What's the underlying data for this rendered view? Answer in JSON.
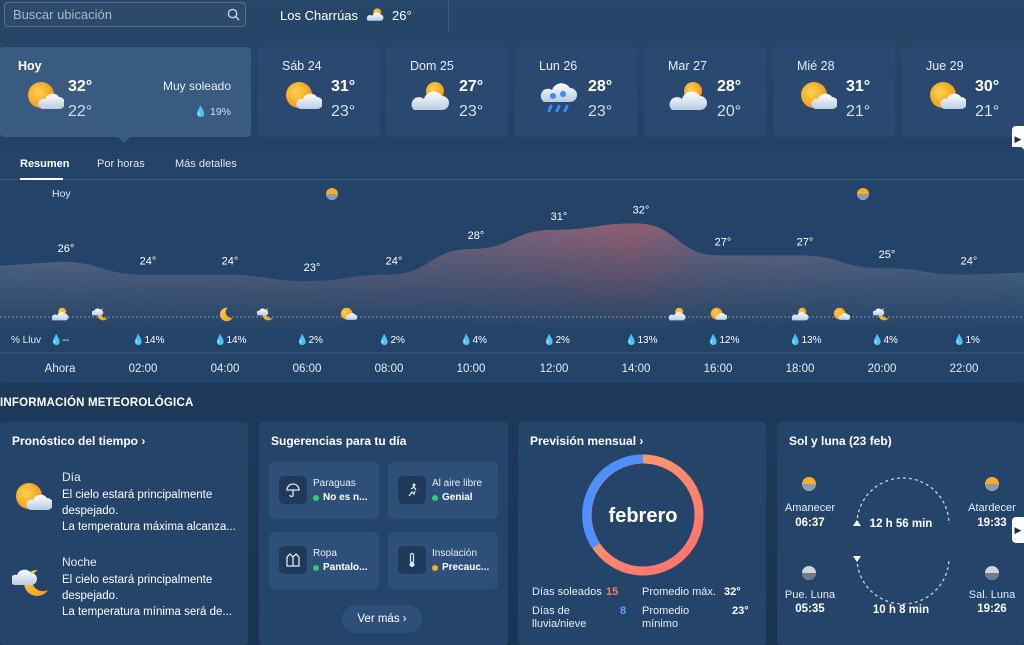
{
  "search": {
    "placeholder": "Buscar ubicación",
    "value": ""
  },
  "location": {
    "name": "Los Charrúas",
    "temp": "26°"
  },
  "today": {
    "label": "Hoy",
    "high": "32°",
    "low": "22°",
    "condition": "Muy soleado",
    "rain": "19%"
  },
  "days": [
    {
      "label": "Sáb 24",
      "high": "31°",
      "low": "23°",
      "icon": "sun-cloud-icon"
    },
    {
      "label": "Dom 25",
      "high": "27°",
      "low": "23°",
      "icon": "cloud-sun-icon"
    },
    {
      "label": "Lun 26",
      "high": "28°",
      "low": "23°",
      "icon": "rain-cloud-icon"
    },
    {
      "label": "Mar 27",
      "high": "28°",
      "low": "20°",
      "icon": "cloud-sun-icon"
    },
    {
      "label": "Mié 28",
      "high": "31°",
      "low": "21°",
      "icon": "sun-cloud-icon"
    },
    {
      "label": "Jue 29",
      "high": "30°",
      "low": "21°",
      "icon": "sun-cloud-icon"
    }
  ],
  "tabs": {
    "summary": "Resumen",
    "hourly": "Por horas",
    "details": "Más detalles"
  },
  "hourly": {
    "today_label": "Hoy",
    "rain_label": "% Lluv",
    "temps": [
      {
        "value": 26,
        "label": "26°"
      },
      {
        "value": 24,
        "label": "24°"
      },
      {
        "value": 24,
        "label": "24°"
      },
      {
        "value": 23,
        "label": "23°"
      },
      {
        "value": 24,
        "label": "24°"
      },
      {
        "value": 28,
        "label": "28°"
      },
      {
        "value": 31,
        "label": "31°"
      },
      {
        "value": 32,
        "label": "32°"
      },
      {
        "value": 27,
        "label": "27°"
      },
      {
        "value": 27,
        "label": "27°"
      },
      {
        "value": 25,
        "label": "25°"
      },
      {
        "value": 24,
        "label": "24°"
      }
    ],
    "rain": [
      "--",
      "14%",
      "14%",
      "2%",
      "2%",
      "4%",
      "2%",
      "13%",
      "12%",
      "13%",
      "4%",
      "1%"
    ],
    "times": [
      "Ahora",
      "02:00",
      "04:00",
      "06:00",
      "08:00",
      "10:00",
      "12:00",
      "14:00",
      "16:00",
      "18:00",
      "20:00",
      "22:00"
    ]
  },
  "info": {
    "section_title": "INFORMACIÓN METEOROLÓGICA",
    "forecast": {
      "title": "Pronóstico del tiempo",
      "day_label": "Día",
      "day_lines": [
        "El cielo estará principalmente",
        "despejado.",
        "La temperatura máxima alcanza..."
      ],
      "night_label": "Noche",
      "night_lines": [
        "El cielo estará principalmente",
        "despejado.",
        "La temperatura mínima será de..."
      ]
    },
    "suggestions": {
      "title": "Sugerencias para tu día",
      "items": [
        {
          "name": "Paraguas",
          "value": "No es n...",
          "color": "#2ecc71"
        },
        {
          "name": "Al aire libre",
          "value": "Genial",
          "color": "#2ecc71"
        },
        {
          "name": "Ropa",
          "value": "Pantalo...",
          "color": "#2ecc71"
        },
        {
          "name": "Insolación",
          "value": "Precauc...",
          "color": "#f1b31c"
        }
      ],
      "more": "Ver más"
    },
    "monthly": {
      "title": "Previsión mensual",
      "month": "febrero",
      "sunny_label": "Días soleados",
      "sunny_value": "15",
      "rain_label": "Días de lluvia/nieve",
      "rain_value": "8",
      "max_label": "Promedio máx.",
      "max_value": "32°",
      "min_label": "Promedio mínimo",
      "min_value": "23°",
      "sunny_color": "#ff7b6b",
      "rain_color": "#5aa3ff"
    },
    "sunmoon": {
      "title": "Sol y luna (23 feb)",
      "sunrise_label": "Amanecer",
      "sunrise": "06:37",
      "sunset_label": "Atardecer",
      "sunset": "19:33",
      "day_length": "12 h 56 min",
      "moonrise_label": "Pue. Luna",
      "moonrise": "05:35",
      "moonset_label": "Sal. Luna",
      "moonset": "19:26",
      "moon_length": "10 h 8 min"
    }
  }
}
